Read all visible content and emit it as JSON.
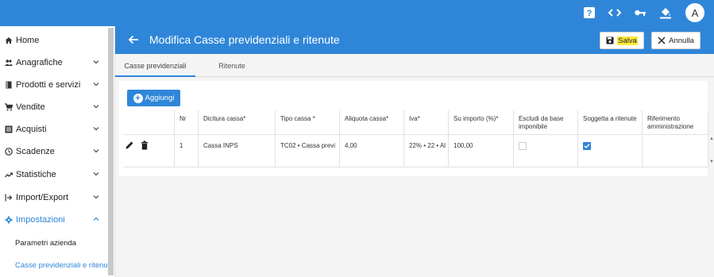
{
  "topbar": {
    "icons": [
      "help-icon",
      "code-icon",
      "key-icon",
      "paint-bucket-icon"
    ],
    "avatar_letter": "A"
  },
  "sidebar": {
    "items": [
      {
        "label": "Home",
        "icon": "home-icon"
      },
      {
        "label": "Anagrafiche",
        "icon": "people-icon"
      },
      {
        "label": "Prodotti e servizi",
        "icon": "book-icon"
      },
      {
        "label": "Vendite",
        "icon": "cart-icon"
      },
      {
        "label": "Acquisti",
        "icon": "list-icon"
      },
      {
        "label": "Scadenze",
        "icon": "clock-icon"
      },
      {
        "label": "Statistiche",
        "icon": "trend-icon"
      },
      {
        "label": "Import/Export",
        "icon": "import-icon"
      },
      {
        "label": "Impostazioni",
        "icon": "gear-icon"
      }
    ],
    "subitems": [
      {
        "label": "Parametri azienda"
      },
      {
        "label": "Casse previdenziali e ritenute"
      }
    ]
  },
  "header": {
    "title": "Modifica Casse previdenziali e ritenute",
    "save_label": "Salva",
    "cancel_label": "Annulla"
  },
  "tabs": [
    {
      "label": "Casse previdenziali"
    },
    {
      "label": "Ritenute"
    }
  ],
  "toolbar": {
    "add_label": "Aggiungi"
  },
  "table": {
    "headers": [
      "Nr",
      "Dicitura cassa*",
      "Tipo cassa *",
      "Aliquota cassa*",
      "Iva*",
      "Su importo (%)*",
      "Escludi da base imponibile",
      "Soggetta a ritenute",
      "Riferimento amministrazione"
    ],
    "rows": [
      {
        "nr": "1",
        "dicitura": "Cassa INPS",
        "tipo": "TC02 • Cassa previ",
        "aliquota": "4,00",
        "iva": "22% • 22 • Al",
        "su_importo": "100,00",
        "escludi": false,
        "soggetta": true,
        "riferimento": ""
      }
    ]
  },
  "colors": {
    "primary": "#2f86d9",
    "highlight": "#ffeb3b",
    "background": "#f4f4f4"
  }
}
